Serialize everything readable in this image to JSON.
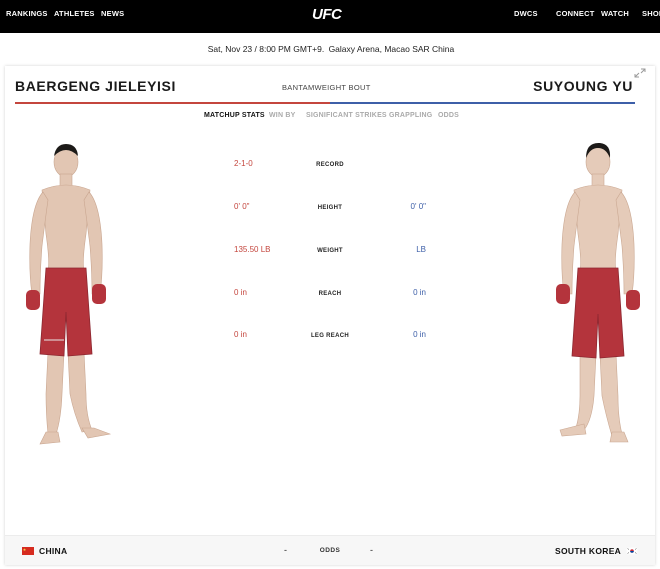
{
  "nav": {
    "left_items": [
      "RANKINGS",
      "ATHLETES",
      "NEWS"
    ],
    "logo": "UFC",
    "right_items": [
      "DWCS",
      "CONNECT",
      "WATCH",
      "SHOP"
    ]
  },
  "event": {
    "datetime": "Sat, Nov 23 / 8:00 PM GMT+9.",
    "venue": "Galaxy Arena, Macao SAR China"
  },
  "bout": {
    "red_name": "BAERGENG JIELEYISI",
    "weight_class": "BANTAMWEIGHT BOUT",
    "blue_name": "SUYOUNG YU"
  },
  "tabs": [
    {
      "label": "MATCHUP STATS",
      "active": true
    },
    {
      "label": "WIN BY",
      "active": false
    },
    {
      "label": "SIGNIFICANT STRIKES",
      "active": false
    },
    {
      "label": "GRAPPLING",
      "active": false
    },
    {
      "label": "ODDS",
      "active": false
    }
  ],
  "stats": [
    {
      "label": "RECORD",
      "red": "2-1-0",
      "blue": ""
    },
    {
      "label": "HEIGHT",
      "red": "0' 0\"",
      "blue": "0' 0\""
    },
    {
      "label": "WEIGHT",
      "red": "135.50 LB",
      "blue": "LB"
    },
    {
      "label": "REACH",
      "red": "0 in",
      "blue": "0 in"
    },
    {
      "label": "LEG REACH",
      "red": "0 in",
      "blue": "0 in"
    }
  ],
  "footer": {
    "red_country": "CHINA",
    "red_odds": "-",
    "odds_label": "ODDS",
    "blue_odds": "-",
    "blue_country": "SOUTH KOREA"
  },
  "colors": {
    "red_corner": "#c4463e",
    "blue_corner": "#3d5fa8",
    "nav_bg": "#000000"
  },
  "icons": {
    "expand": "expand-icon",
    "china_flag": "china-flag-icon",
    "korea_flag": "south-korea-flag-icon"
  }
}
